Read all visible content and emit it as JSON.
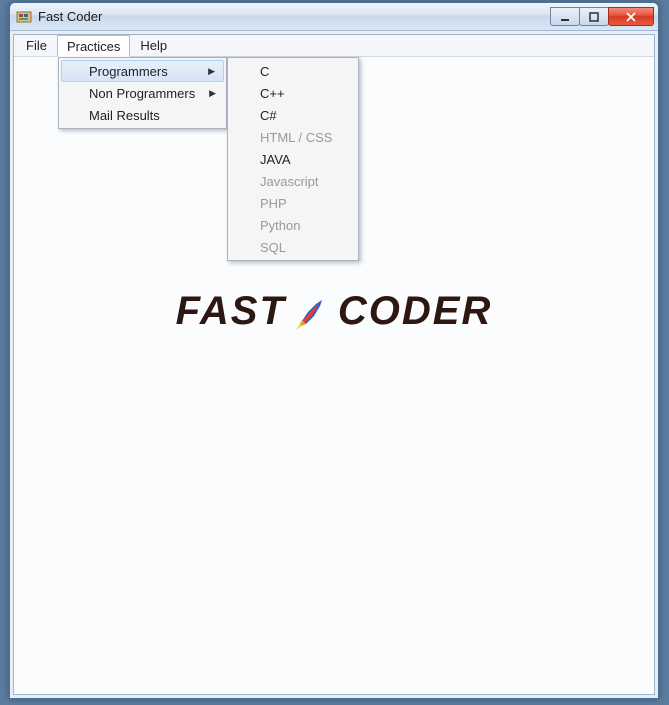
{
  "window": {
    "title": "Fast Coder"
  },
  "menubar": {
    "file": "File",
    "practices": "Practices",
    "help": "Help"
  },
  "practices_menu": {
    "programmers": "Programmers",
    "non_programmers": "Non Programmers",
    "mail_results": "Mail Results"
  },
  "programmers_submenu": {
    "c": "C",
    "cpp": "C++",
    "csharp": "C#",
    "htmlcss": "HTML / CSS",
    "java": "JAVA",
    "javascript": "Javascript",
    "php": "PHP",
    "python": "Python",
    "sql": "SQL"
  },
  "logo": {
    "left": "FAST",
    "right": "CODER"
  },
  "disabled_items": [
    "htmlcss",
    "javascript",
    "php",
    "python",
    "sql"
  ]
}
